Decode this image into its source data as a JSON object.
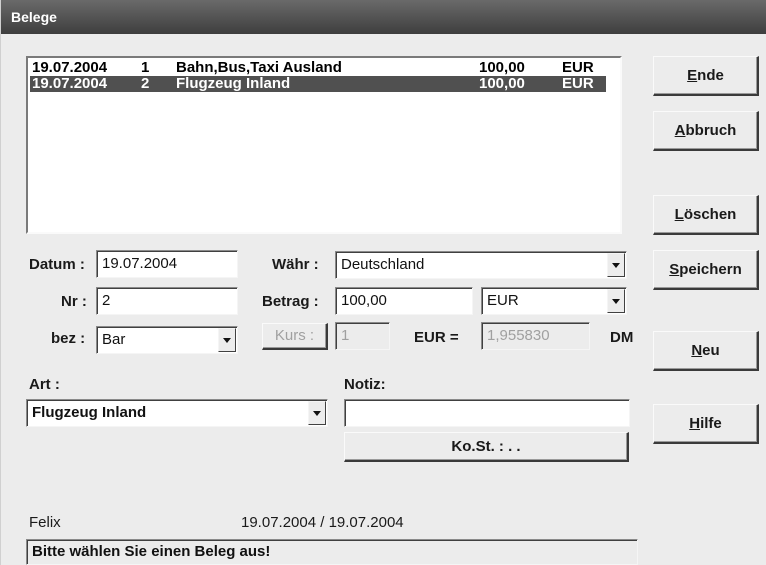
{
  "window": {
    "title": "Belege"
  },
  "list": {
    "rows": [
      {
        "date": "19.07.2004",
        "nr": "1",
        "desc": "Bahn,Bus,Taxi  Ausland",
        "amount": "100,00",
        "currency": "EUR",
        "selected": false
      },
      {
        "date": "19.07.2004",
        "nr": "2",
        "desc": "Flugzeug Inland",
        "amount": "100,00",
        "currency": "EUR",
        "selected": true
      }
    ]
  },
  "form": {
    "datum_label": "Datum :",
    "datum_value": "19.07.2004",
    "waehr_label": "Währ :",
    "waehr_value": "Deutschland",
    "nr_label": "Nr :",
    "nr_value": "2",
    "betrag_label": "Betrag :",
    "betrag_value": "100,00",
    "currency_value": "EUR",
    "bez_label": "bez :",
    "bez_value": "Bar",
    "kurs_button": "Kurs :",
    "kurs_value": "1",
    "eur_eq_label": "EUR =",
    "rate_value": "1,955830",
    "dm_label": "DM",
    "art_label": "Art :",
    "art_value": "Flugzeug Inland",
    "notiz_label": "Notiz:",
    "notiz_value": "",
    "kost_button": "Ko.St. :  .  ."
  },
  "footer": {
    "user": "Felix",
    "dates": "19.07.2004 / 19.07.2004",
    "status": "Bitte wählen Sie einen Beleg aus!"
  },
  "buttons": {
    "ende": {
      "hot": "E",
      "rest": "nde"
    },
    "abbruch": {
      "hot": "A",
      "rest": "bbruch"
    },
    "loeschen": {
      "hot": "L",
      "rest": "öschen"
    },
    "speichern": {
      "hot": "S",
      "rest": "peichern"
    },
    "neu": {
      "hot": "N",
      "rest": "eu"
    },
    "hilfe": {
      "hot": "H",
      "rest": "ilfe"
    }
  }
}
